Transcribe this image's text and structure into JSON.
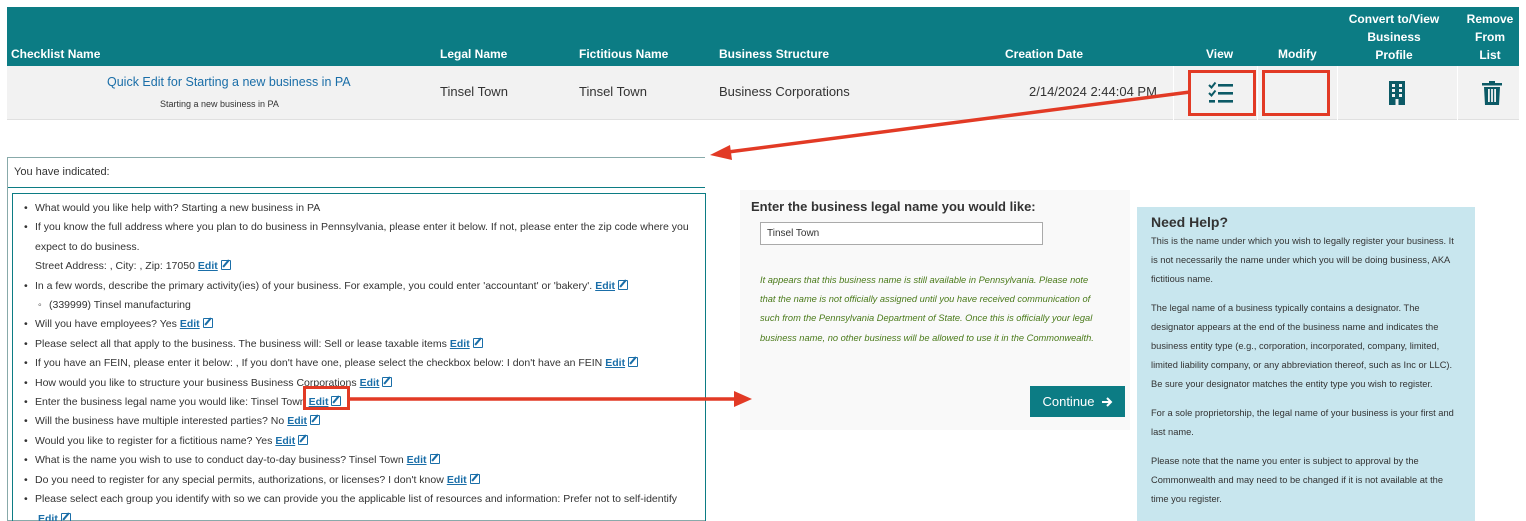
{
  "table": {
    "headers": {
      "checklist_name": "Checklist Name",
      "legal_name": "Legal Name",
      "fictitious_name": "Fictitious Name",
      "business_structure": "Business Structure",
      "creation_date": "Creation Date",
      "view": "View",
      "modify": "Modify",
      "convert_line1": "Convert to/View",
      "convert_line2": "Business",
      "convert_line3": "Profile",
      "remove_line1": "Remove",
      "remove_line2": "From",
      "remove_line3": "List"
    },
    "row": {
      "checklist_title": "Quick Edit for Starting a new business in PA",
      "checklist_subtitle": "Starting a new business in PA",
      "legal_name": "Tinsel Town",
      "fictitious_name": "Tinsel Town",
      "business_structure": "Business Corporations",
      "creation_date": "2/14/2024 2:44:04 PM"
    },
    "icons": {
      "view": "checklist-icon",
      "convert": "building-icon",
      "remove": "trash-icon"
    }
  },
  "summary": {
    "header": "You have indicated:",
    "edit_label": "Edit",
    "items": [
      {
        "text": "What would you like help with? Starting a new business in PA",
        "edit": false
      },
      {
        "text": "If you know the full address where you plan to do business in Pennsylvania, please enter it below. If not, please enter the zip code where you",
        "edit": false
      },
      {
        "text": "expect to do business.",
        "edit": false,
        "cont": true
      },
      {
        "text": "Street Address: , City: , Zip: 17050",
        "edit": true,
        "cont": true
      },
      {
        "text": "In a few words, describe the primary activity(ies) of your business. For example, you could enter 'accountant' or 'bakery'.",
        "edit": true
      },
      {
        "text": "(339999) Tinsel manufacturing",
        "edit": false,
        "sub": true
      },
      {
        "text": "Will you have employees? Yes",
        "edit": true
      },
      {
        "text": "Please select all that apply to the business. The business will: Sell or lease taxable items",
        "edit": true
      },
      {
        "text": "If you have an FEIN, please enter it below: , If you don't have one, please select the checkbox below: I don't have an FEIN",
        "edit": true
      },
      {
        "text": "How would you like to structure your business Business Corporations",
        "edit": true
      },
      {
        "text": "Enter the business legal name you would like: Tinsel Town",
        "edit": true
      },
      {
        "text": "Will the business have multiple interested parties? No",
        "edit": true
      },
      {
        "text": "Would you like to register for a fictitious name? Yes",
        "edit": true
      },
      {
        "text": "What is the name you wish to use to conduct day-to-day business? Tinsel Town",
        "edit": true
      },
      {
        "text": "Do you need to register for any special permits, authorizations, or licenses? I don't know",
        "edit": true
      },
      {
        "text": "Please select each group you identify with so we can provide you the applicable list of resources and information: Prefer not to self-identify",
        "edit": false
      },
      {
        "text": "",
        "edit": true,
        "cont": true
      }
    ]
  },
  "form": {
    "title": "Enter the business legal name you would like:",
    "input_value": "Tinsel Town",
    "message": "It appears that this business name is still available in Pennsylvania. Please note that the name is not officially assigned until you have received communication of such from the Pennsylvania Department of State. Once this is officially your legal business name, no other business will be allowed to use it in the Commonwealth.",
    "continue_label": "Continue",
    "continue_icon": "arrow-right-icon"
  },
  "help": {
    "title": "Need Help?",
    "paragraphs": [
      "This is the name under which you wish to legally register your business. It is not necessarily the name under which you will be doing business, AKA fictitious name.",
      "The legal name of a business typically contains a designator. The designator appears at the end of the business name and indicates the business entity type (e.g., corporation, incorporated, company, limited, limited liability company, or any abbreviation thereof, such as Inc or LLC). Be sure your designator matches the entity type you wish to register.",
      "For a sole proprietorship, the legal name of your business is your first and last name.",
      "Please note that the name you enter is subject to approval by the Commonwealth and may need to be changed if it is not available at the time you register."
    ]
  },
  "colors": {
    "teal": "#0c7c84",
    "highlight_red": "#e23a25",
    "help_bg": "#c8e6ee"
  }
}
